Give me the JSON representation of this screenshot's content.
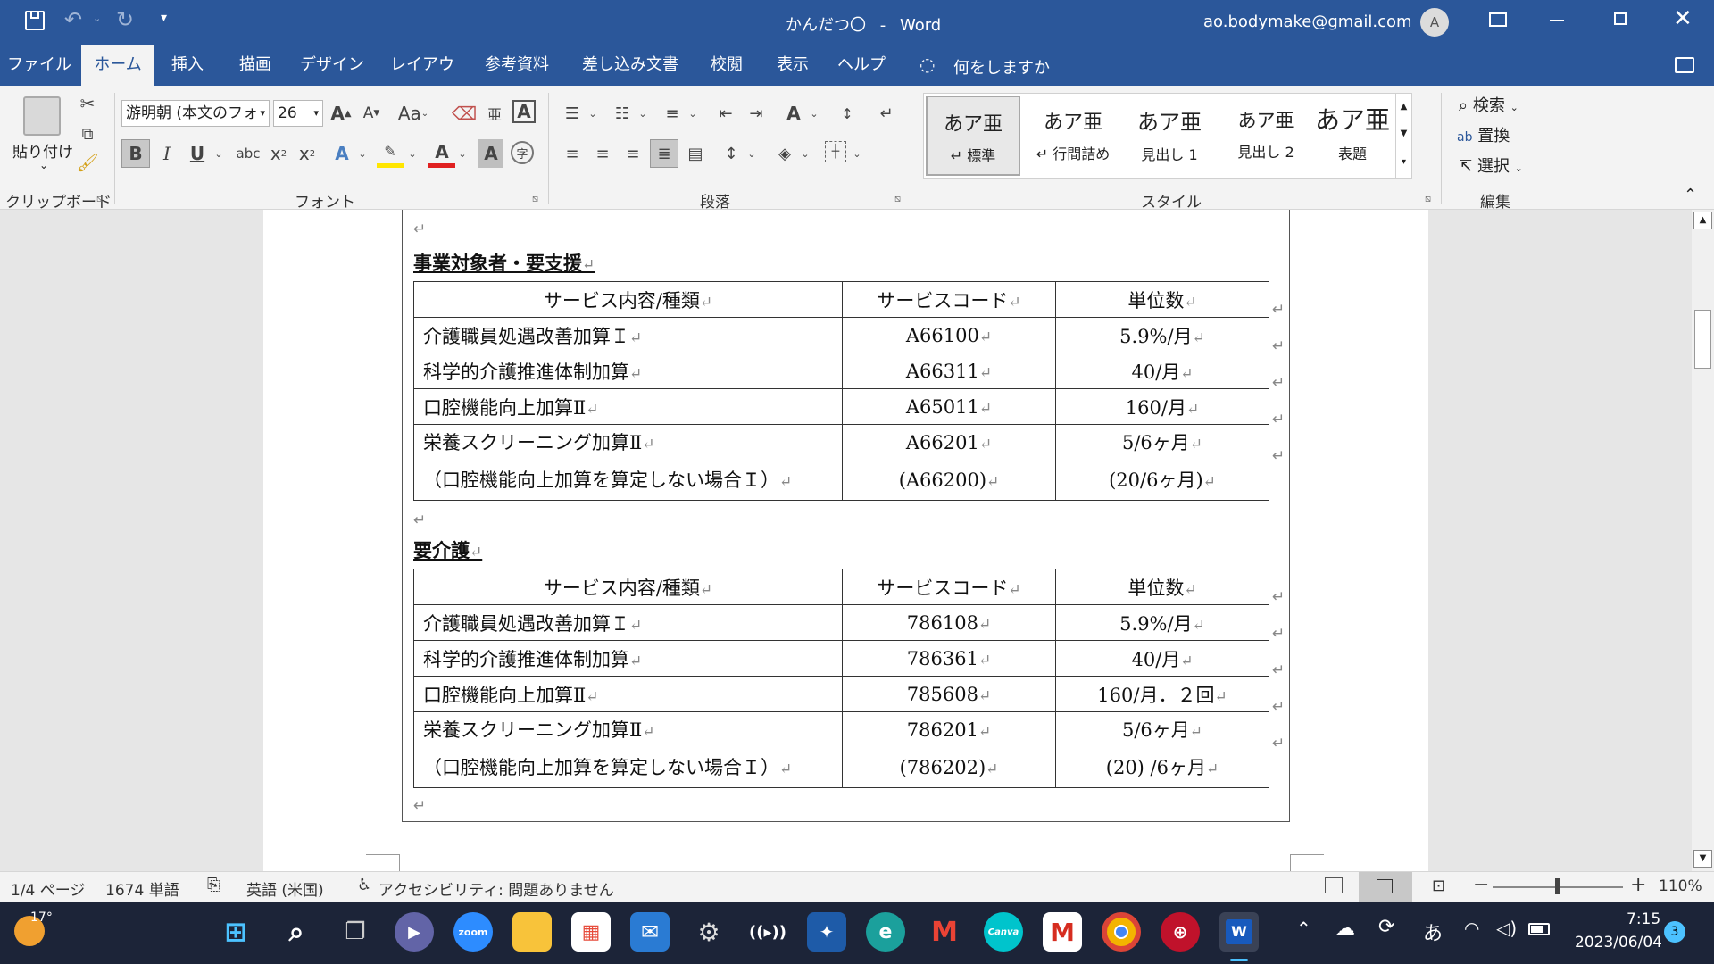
{
  "titlebar": {
    "doc_title": "かんだつ〇",
    "separator": "-",
    "app_name": "Word",
    "account": "ao.bodymake@gmail.com",
    "avatar_letter": "A"
  },
  "tabs": [
    "ファイル",
    "ホーム",
    "挿入",
    "描画",
    "デザイン",
    "レイアウト",
    "参考資料",
    "差し込み文書",
    "校閲",
    "表示",
    "ヘルプ"
  ],
  "tell_me": "何をしますか",
  "ribbon": {
    "paste_label": "貼り付け",
    "font_name": "游明朝 (本文のフォ",
    "font_size": "26",
    "case_button": "Aa",
    "groups": {
      "clipboard": "クリップボード",
      "font": "フォント",
      "paragraph": "段落",
      "styles": "スタイル",
      "editing": "編集"
    },
    "styles": [
      {
        "sample": "あア亜",
        "name": "↵ 標準"
      },
      {
        "sample": "あア亜",
        "name": "↵ 行間詰め"
      },
      {
        "sample": "あア亜",
        "name": "見出し 1"
      },
      {
        "sample": "あア亜",
        "name": "見出し 2"
      },
      {
        "sample": "あア亜",
        "name": "表題"
      }
    ],
    "editing": {
      "find": "検索",
      "replace": "置換",
      "select": "選択"
    }
  },
  "document": {
    "section1": {
      "heading": "事業対象者・要支援",
      "headers": [
        "サービス内容/種類",
        "サービスコード",
        "単位数"
      ],
      "rows": [
        {
          "name": "介護職員処遇改善加算Ｉ",
          "code": "A66100",
          "units": "5.9%/月"
        },
        {
          "name": "科学的介護推進体制加算",
          "code": "A66311",
          "units": "40/月"
        },
        {
          "name": "口腔機能向上加算Ⅱ",
          "code": "A65011",
          "units": "160/月"
        },
        {
          "name": "栄養スクリーニング加算Ⅱ",
          "name2": "（口腔機能向上加算を算定しない場合Ｉ）",
          "code": "A66201",
          "code2": "(A66200)",
          "units": "5/6ヶ月",
          "units2": "(20/6ヶ月)"
        }
      ]
    },
    "section2": {
      "heading": "要介護",
      "headers": [
        "サービス内容/種類",
        "サービスコード",
        "単位数"
      ],
      "rows": [
        {
          "name": "介護職員処遇改善加算Ｉ",
          "code": "786108",
          "units": "5.9%/月"
        },
        {
          "name": "科学的介護推進体制加算",
          "code": "786361",
          "units": "40/月"
        },
        {
          "name": "口腔機能向上加算Ⅱ",
          "code": "785608",
          "units": "160/月．２回"
        },
        {
          "name": "栄養スクリーニング加算Ⅱ",
          "name2": "（口腔機能向上加算を算定しない場合Ｉ）",
          "code": "786201",
          "code2": "(786202)",
          "units": "5/6ヶ月",
          "units2": "(20) /6ヶ月"
        }
      ]
    }
  },
  "statusbar": {
    "page": "1/4 ページ",
    "words": "1674 単語",
    "language": "英語 (米国)",
    "accessibility": "アクセシビリティ: 問題ありません",
    "zoom": "110%",
    "zoom_fraction": 0.5
  },
  "taskbar": {
    "weather_temp": "17°",
    "time": "7:15",
    "date": "2023/06/04",
    "notif_count": "3",
    "ime": "あ",
    "zoom_app": "zoom",
    "canva_app": "Canva"
  },
  "colors": {
    "word_blue": "#2b579a",
    "taskbar": "#1c2438"
  }
}
